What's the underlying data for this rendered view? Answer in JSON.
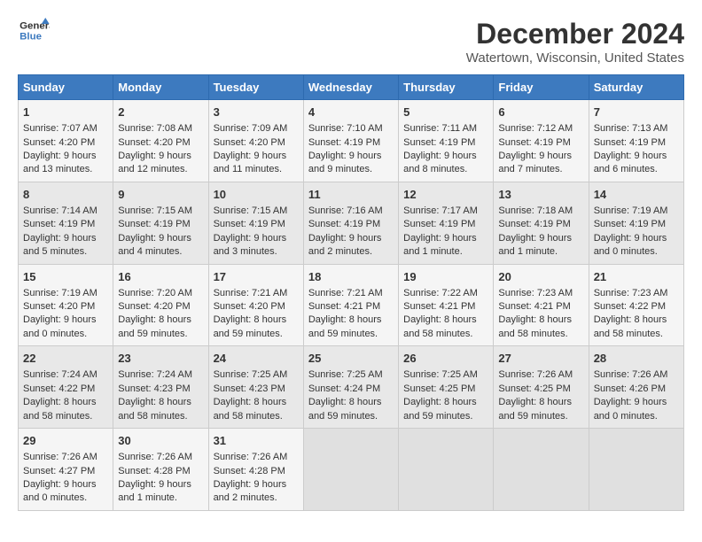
{
  "logo": {
    "line1": "General",
    "line2": "Blue"
  },
  "title": "December 2024",
  "subtitle": "Watertown, Wisconsin, United States",
  "days_of_week": [
    "Sunday",
    "Monday",
    "Tuesday",
    "Wednesday",
    "Thursday",
    "Friday",
    "Saturday"
  ],
  "weeks": [
    [
      {
        "day": "1",
        "lines": [
          "Sunrise: 7:07 AM",
          "Sunset: 4:20 PM",
          "Daylight: 9 hours",
          "and 13 minutes."
        ]
      },
      {
        "day": "2",
        "lines": [
          "Sunrise: 7:08 AM",
          "Sunset: 4:20 PM",
          "Daylight: 9 hours",
          "and 12 minutes."
        ]
      },
      {
        "day": "3",
        "lines": [
          "Sunrise: 7:09 AM",
          "Sunset: 4:20 PM",
          "Daylight: 9 hours",
          "and 11 minutes."
        ]
      },
      {
        "day": "4",
        "lines": [
          "Sunrise: 7:10 AM",
          "Sunset: 4:19 PM",
          "Daylight: 9 hours",
          "and 9 minutes."
        ]
      },
      {
        "day": "5",
        "lines": [
          "Sunrise: 7:11 AM",
          "Sunset: 4:19 PM",
          "Daylight: 9 hours",
          "and 8 minutes."
        ]
      },
      {
        "day": "6",
        "lines": [
          "Sunrise: 7:12 AM",
          "Sunset: 4:19 PM",
          "Daylight: 9 hours",
          "and 7 minutes."
        ]
      },
      {
        "day": "7",
        "lines": [
          "Sunrise: 7:13 AM",
          "Sunset: 4:19 PM",
          "Daylight: 9 hours",
          "and 6 minutes."
        ]
      }
    ],
    [
      {
        "day": "8",
        "lines": [
          "Sunrise: 7:14 AM",
          "Sunset: 4:19 PM",
          "Daylight: 9 hours",
          "and 5 minutes."
        ]
      },
      {
        "day": "9",
        "lines": [
          "Sunrise: 7:15 AM",
          "Sunset: 4:19 PM",
          "Daylight: 9 hours",
          "and 4 minutes."
        ]
      },
      {
        "day": "10",
        "lines": [
          "Sunrise: 7:15 AM",
          "Sunset: 4:19 PM",
          "Daylight: 9 hours",
          "and 3 minutes."
        ]
      },
      {
        "day": "11",
        "lines": [
          "Sunrise: 7:16 AM",
          "Sunset: 4:19 PM",
          "Daylight: 9 hours",
          "and 2 minutes."
        ]
      },
      {
        "day": "12",
        "lines": [
          "Sunrise: 7:17 AM",
          "Sunset: 4:19 PM",
          "Daylight: 9 hours",
          "and 1 minute."
        ]
      },
      {
        "day": "13",
        "lines": [
          "Sunrise: 7:18 AM",
          "Sunset: 4:19 PM",
          "Daylight: 9 hours",
          "and 1 minute."
        ]
      },
      {
        "day": "14",
        "lines": [
          "Sunrise: 7:19 AM",
          "Sunset: 4:19 PM",
          "Daylight: 9 hours",
          "and 0 minutes."
        ]
      }
    ],
    [
      {
        "day": "15",
        "lines": [
          "Sunrise: 7:19 AM",
          "Sunset: 4:20 PM",
          "Daylight: 9 hours",
          "and 0 minutes."
        ]
      },
      {
        "day": "16",
        "lines": [
          "Sunrise: 7:20 AM",
          "Sunset: 4:20 PM",
          "Daylight: 8 hours",
          "and 59 minutes."
        ]
      },
      {
        "day": "17",
        "lines": [
          "Sunrise: 7:21 AM",
          "Sunset: 4:20 PM",
          "Daylight: 8 hours",
          "and 59 minutes."
        ]
      },
      {
        "day": "18",
        "lines": [
          "Sunrise: 7:21 AM",
          "Sunset: 4:21 PM",
          "Daylight: 8 hours",
          "and 59 minutes."
        ]
      },
      {
        "day": "19",
        "lines": [
          "Sunrise: 7:22 AM",
          "Sunset: 4:21 PM",
          "Daylight: 8 hours",
          "and 58 minutes."
        ]
      },
      {
        "day": "20",
        "lines": [
          "Sunrise: 7:23 AM",
          "Sunset: 4:21 PM",
          "Daylight: 8 hours",
          "and 58 minutes."
        ]
      },
      {
        "day": "21",
        "lines": [
          "Sunrise: 7:23 AM",
          "Sunset: 4:22 PM",
          "Daylight: 8 hours",
          "and 58 minutes."
        ]
      }
    ],
    [
      {
        "day": "22",
        "lines": [
          "Sunrise: 7:24 AM",
          "Sunset: 4:22 PM",
          "Daylight: 8 hours",
          "and 58 minutes."
        ]
      },
      {
        "day": "23",
        "lines": [
          "Sunrise: 7:24 AM",
          "Sunset: 4:23 PM",
          "Daylight: 8 hours",
          "and 58 minutes."
        ]
      },
      {
        "day": "24",
        "lines": [
          "Sunrise: 7:25 AM",
          "Sunset: 4:23 PM",
          "Daylight: 8 hours",
          "and 58 minutes."
        ]
      },
      {
        "day": "25",
        "lines": [
          "Sunrise: 7:25 AM",
          "Sunset: 4:24 PM",
          "Daylight: 8 hours",
          "and 59 minutes."
        ]
      },
      {
        "day": "26",
        "lines": [
          "Sunrise: 7:25 AM",
          "Sunset: 4:25 PM",
          "Daylight: 8 hours",
          "and 59 minutes."
        ]
      },
      {
        "day": "27",
        "lines": [
          "Sunrise: 7:26 AM",
          "Sunset: 4:25 PM",
          "Daylight: 8 hours",
          "and 59 minutes."
        ]
      },
      {
        "day": "28",
        "lines": [
          "Sunrise: 7:26 AM",
          "Sunset: 4:26 PM",
          "Daylight: 9 hours",
          "and 0 minutes."
        ]
      }
    ],
    [
      {
        "day": "29",
        "lines": [
          "Sunrise: 7:26 AM",
          "Sunset: 4:27 PM",
          "Daylight: 9 hours",
          "and 0 minutes."
        ]
      },
      {
        "day": "30",
        "lines": [
          "Sunrise: 7:26 AM",
          "Sunset: 4:28 PM",
          "Daylight: 9 hours",
          "and 1 minute."
        ]
      },
      {
        "day": "31",
        "lines": [
          "Sunrise: 7:26 AM",
          "Sunset: 4:28 PM",
          "Daylight: 9 hours",
          "and 2 minutes."
        ]
      },
      null,
      null,
      null,
      null
    ]
  ]
}
